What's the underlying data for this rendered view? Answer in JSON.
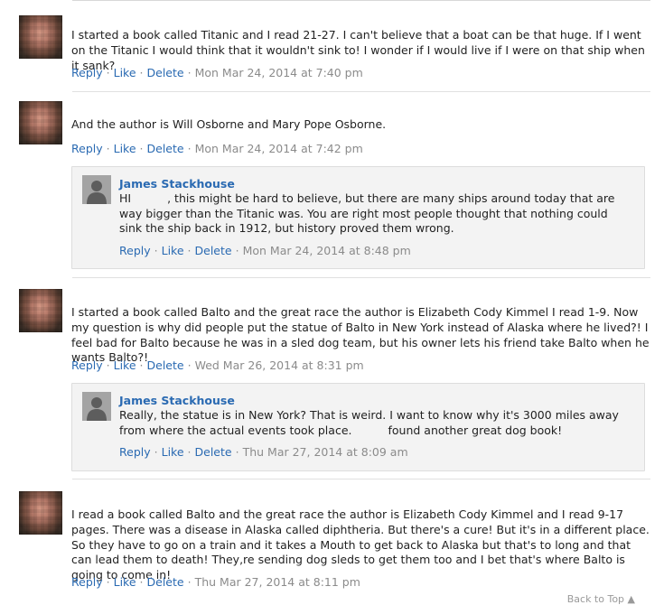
{
  "comments": [
    {
      "text": "I started a book called Titanic and I read 21-27. I can't believe that a boat can be that huge. If I went on the Titanic I would think that it wouldn't sink to! I wonder if I would live if I were on that ship when it sank?",
      "reply": "Reply",
      "like": "Like",
      "delete": "Delete",
      "timestamp": "Mon Mar 24, 2014 at 7:40 pm"
    },
    {
      "text": "And the author is Will Osborne and Mary Pope Osborne.",
      "reply": "Reply",
      "like": "Like",
      "delete": "Delete",
      "timestamp": "Mon Mar 24, 2014 at 7:42 pm",
      "response": {
        "author": "James Stackhouse",
        "text_start": "HI",
        "text_rest": ", this might be hard to believe, but there are many ships around today that are way bigger than the Titanic was. You are right most people thought that nothing could sink the ship back in 1912, but history proved them wrong.",
        "reply": "Reply",
        "like": "Like",
        "delete": "Delete",
        "timestamp": "Mon Mar 24, 2014 at 8:48 pm"
      }
    },
    {
      "text": "I started a book called Balto and the great race the author is Elizabeth Cody Kimmel I read 1-9. Now my question is why did people put the statue of Balto in New York instead of Alaska where he lived?! I feel bad for Balto because he was in a sled dog team, but his owner lets his friend take Balto when he wants Balto?!",
      "reply": "Reply",
      "like": "Like",
      "delete": "Delete",
      "timestamp": "Wed Mar 26, 2014 at 8:31 pm",
      "response": {
        "author": "James Stackhouse",
        "text_start": "Really, the statue is in New York? That is weird. I want to know why it's 3000 miles away from where the actual events took place.",
        "text_rest": "found another great dog book!",
        "reply": "Reply",
        "like": "Like",
        "delete": "Delete",
        "timestamp": "Thu Mar 27, 2014 at 8:09 am"
      }
    },
    {
      "text": "I read a book called Balto and the great race the author is Elizabeth Cody Kimmel and I read 9-17 pages. There was a disease in Alaska called diphtheria. But there's a cure! But it's in a different place. So they have to go on a train and it takes a Mouth to get back to Alaska but that's to long and that can lead them to death! They,re sending dog sleds to get them too and I bet that's where Balto is going to come in!",
      "reply": "Reply",
      "like": "Like",
      "delete": "Delete",
      "timestamp": "Thu Mar 27, 2014 at 8:11 pm"
    }
  ],
  "footer": {
    "back_to_top": "Back to Top ▲"
  },
  "colors": {
    "link": "#2a6ab2",
    "meta": "#8b8b8b",
    "reply_bg": "#f3f3f3"
  },
  "icons": {
    "avatar": "blurred-user-avatar",
    "reply_avatar": "default-user-silhouette-icon"
  }
}
